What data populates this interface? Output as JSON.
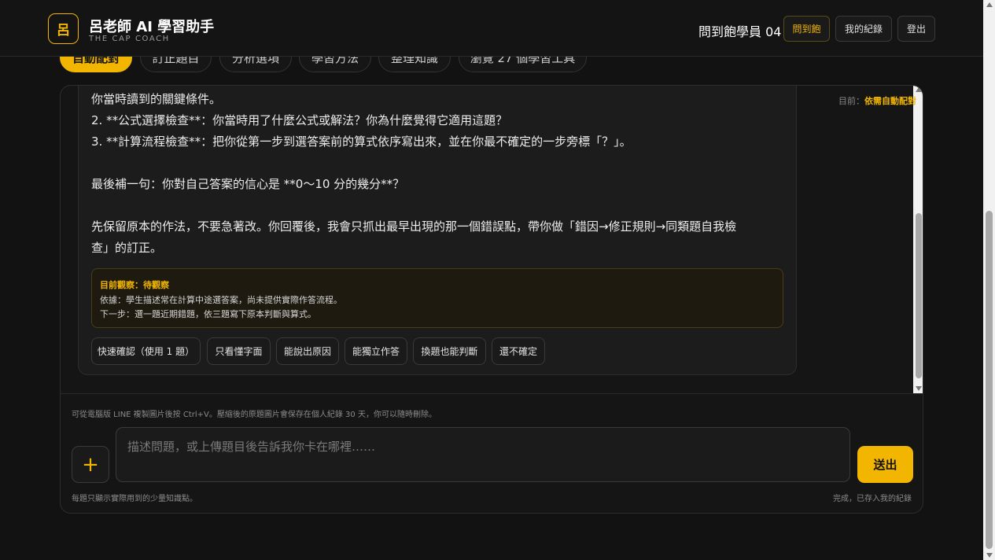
{
  "header": {
    "logo_char": "呂",
    "title": "呂老師 AI 學習助手",
    "subtitle": "THE CAP COACH",
    "user": "問到飽學員 04",
    "buttons": [
      "問到飽",
      "我的紀錄",
      "登出"
    ]
  },
  "tabs": {
    "items": [
      "自動配對",
      "訂正題目",
      "分析選項",
      "學習方法",
      "整理知識",
      "瀏覽 27 個學習工具"
    ],
    "active_index": 0,
    "status_prefix": "目前：",
    "status_value": "依需自動配對"
  },
  "message": {
    "lines": [
      "你當時讀到的關鍵條件。",
      "2. **公式選擇檢查**：你當時用了什麼公式或解法？你為什麼覺得它適用這題？",
      "3. **計算流程檢查**：把你從第一步到選答案前的算式依序寫出來，並在你最不確定的一步旁標「？」。",
      "最後補一句：你對自己答案的信心是 **0～10 分的幾分**？",
      "先保留原本的作法，不要急著改。你回覆後，我會只抓出最早出現的那一個錯誤點，帶你做「錯因→修正規則→同類題自我檢",
      "查」的訂正。"
    ],
    "observation": {
      "title": "目前觀察：待觀察",
      "basis": "依據：學生描述常在計算中途選答案，尚未提供實際作答流程。",
      "next": "下一步：選一題近期錯題，依三題寫下原本判斷與算式。"
    },
    "quick_replies": [
      "快速確認（使用 1 題）",
      "只看懂字面",
      "能說出原因",
      "能獨立作答",
      "換題也能判斷",
      "還不確定"
    ]
  },
  "composer": {
    "hint_top": "可從電腦版 LINE 複製圖片後按 Ctrl+V。壓縮後的原題圖片會保存在個人紀錄 30 天，你可以隨時刪除。",
    "placeholder": "描述問題，或上傳題目後告訴我你卡在哪裡……",
    "plus": "+",
    "send": "送出",
    "hint_left": "每題只顯示實際用到的少量知識點。",
    "hint_right": "完成，已存入我的紀錄"
  },
  "colors": {
    "accent": "#f2b600",
    "background": "#121212"
  }
}
